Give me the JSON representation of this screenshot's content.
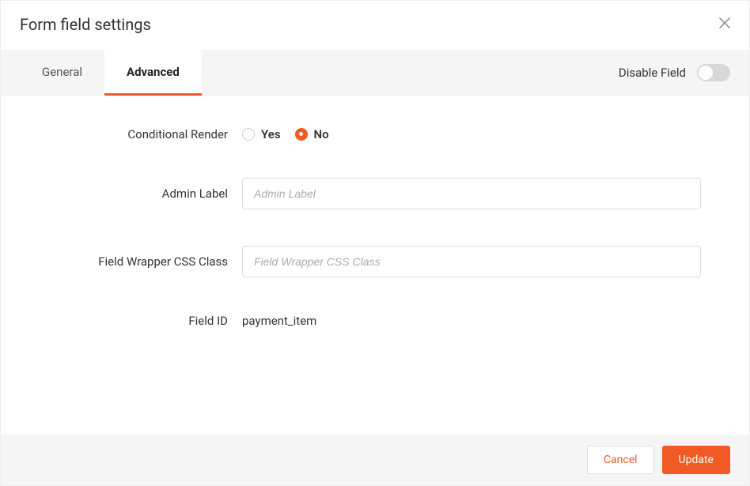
{
  "header": {
    "title": "Form field settings"
  },
  "tabs": {
    "general": "General",
    "advanced": "Advanced",
    "active": "advanced"
  },
  "tabbar": {
    "disable_label": "Disable Field",
    "disable_state": false
  },
  "fields": {
    "conditional_render": {
      "label": "Conditional Render",
      "yes": "Yes",
      "no": "No",
      "value": "no"
    },
    "admin_label": {
      "label": "Admin Label",
      "placeholder": "Admin Label",
      "value": ""
    },
    "wrapper_css": {
      "label": "Field Wrapper CSS Class",
      "placeholder": "Field Wrapper CSS Class",
      "value": ""
    },
    "field_id": {
      "label": "Field ID",
      "value": "payment_item"
    }
  },
  "footer": {
    "cancel": "Cancel",
    "update": "Update"
  }
}
